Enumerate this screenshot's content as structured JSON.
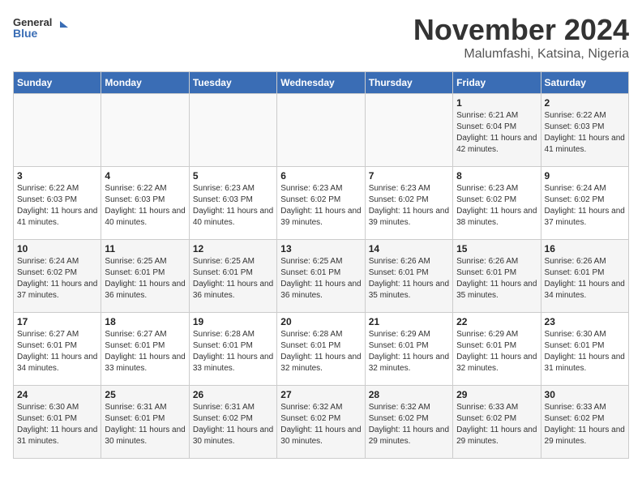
{
  "header": {
    "logo_line1": "General",
    "logo_line2": "Blue",
    "month": "November 2024",
    "location": "Malumfashi, Katsina, Nigeria"
  },
  "weekdays": [
    "Sunday",
    "Monday",
    "Tuesday",
    "Wednesday",
    "Thursday",
    "Friday",
    "Saturday"
  ],
  "weeks": [
    [
      {
        "day": "",
        "info": ""
      },
      {
        "day": "",
        "info": ""
      },
      {
        "day": "",
        "info": ""
      },
      {
        "day": "",
        "info": ""
      },
      {
        "day": "",
        "info": ""
      },
      {
        "day": "1",
        "info": "Sunrise: 6:21 AM\nSunset: 6:04 PM\nDaylight: 11 hours and 42 minutes."
      },
      {
        "day": "2",
        "info": "Sunrise: 6:22 AM\nSunset: 6:03 PM\nDaylight: 11 hours and 41 minutes."
      }
    ],
    [
      {
        "day": "3",
        "info": "Sunrise: 6:22 AM\nSunset: 6:03 PM\nDaylight: 11 hours and 41 minutes."
      },
      {
        "day": "4",
        "info": "Sunrise: 6:22 AM\nSunset: 6:03 PM\nDaylight: 11 hours and 40 minutes."
      },
      {
        "day": "5",
        "info": "Sunrise: 6:23 AM\nSunset: 6:03 PM\nDaylight: 11 hours and 40 minutes."
      },
      {
        "day": "6",
        "info": "Sunrise: 6:23 AM\nSunset: 6:02 PM\nDaylight: 11 hours and 39 minutes."
      },
      {
        "day": "7",
        "info": "Sunrise: 6:23 AM\nSunset: 6:02 PM\nDaylight: 11 hours and 39 minutes."
      },
      {
        "day": "8",
        "info": "Sunrise: 6:23 AM\nSunset: 6:02 PM\nDaylight: 11 hours and 38 minutes."
      },
      {
        "day": "9",
        "info": "Sunrise: 6:24 AM\nSunset: 6:02 PM\nDaylight: 11 hours and 37 minutes."
      }
    ],
    [
      {
        "day": "10",
        "info": "Sunrise: 6:24 AM\nSunset: 6:02 PM\nDaylight: 11 hours and 37 minutes."
      },
      {
        "day": "11",
        "info": "Sunrise: 6:25 AM\nSunset: 6:01 PM\nDaylight: 11 hours and 36 minutes."
      },
      {
        "day": "12",
        "info": "Sunrise: 6:25 AM\nSunset: 6:01 PM\nDaylight: 11 hours and 36 minutes."
      },
      {
        "day": "13",
        "info": "Sunrise: 6:25 AM\nSunset: 6:01 PM\nDaylight: 11 hours and 36 minutes."
      },
      {
        "day": "14",
        "info": "Sunrise: 6:26 AM\nSunset: 6:01 PM\nDaylight: 11 hours and 35 minutes."
      },
      {
        "day": "15",
        "info": "Sunrise: 6:26 AM\nSunset: 6:01 PM\nDaylight: 11 hours and 35 minutes."
      },
      {
        "day": "16",
        "info": "Sunrise: 6:26 AM\nSunset: 6:01 PM\nDaylight: 11 hours and 34 minutes."
      }
    ],
    [
      {
        "day": "17",
        "info": "Sunrise: 6:27 AM\nSunset: 6:01 PM\nDaylight: 11 hours and 34 minutes."
      },
      {
        "day": "18",
        "info": "Sunrise: 6:27 AM\nSunset: 6:01 PM\nDaylight: 11 hours and 33 minutes."
      },
      {
        "day": "19",
        "info": "Sunrise: 6:28 AM\nSunset: 6:01 PM\nDaylight: 11 hours and 33 minutes."
      },
      {
        "day": "20",
        "info": "Sunrise: 6:28 AM\nSunset: 6:01 PM\nDaylight: 11 hours and 32 minutes."
      },
      {
        "day": "21",
        "info": "Sunrise: 6:29 AM\nSunset: 6:01 PM\nDaylight: 11 hours and 32 minutes."
      },
      {
        "day": "22",
        "info": "Sunrise: 6:29 AM\nSunset: 6:01 PM\nDaylight: 11 hours and 32 minutes."
      },
      {
        "day": "23",
        "info": "Sunrise: 6:30 AM\nSunset: 6:01 PM\nDaylight: 11 hours and 31 minutes."
      }
    ],
    [
      {
        "day": "24",
        "info": "Sunrise: 6:30 AM\nSunset: 6:01 PM\nDaylight: 11 hours and 31 minutes."
      },
      {
        "day": "25",
        "info": "Sunrise: 6:31 AM\nSunset: 6:01 PM\nDaylight: 11 hours and 30 minutes."
      },
      {
        "day": "26",
        "info": "Sunrise: 6:31 AM\nSunset: 6:02 PM\nDaylight: 11 hours and 30 minutes."
      },
      {
        "day": "27",
        "info": "Sunrise: 6:32 AM\nSunset: 6:02 PM\nDaylight: 11 hours and 30 minutes."
      },
      {
        "day": "28",
        "info": "Sunrise: 6:32 AM\nSunset: 6:02 PM\nDaylight: 11 hours and 29 minutes."
      },
      {
        "day": "29",
        "info": "Sunrise: 6:33 AM\nSunset: 6:02 PM\nDaylight: 11 hours and 29 minutes."
      },
      {
        "day": "30",
        "info": "Sunrise: 6:33 AM\nSunset: 6:02 PM\nDaylight: 11 hours and 29 minutes."
      }
    ]
  ]
}
